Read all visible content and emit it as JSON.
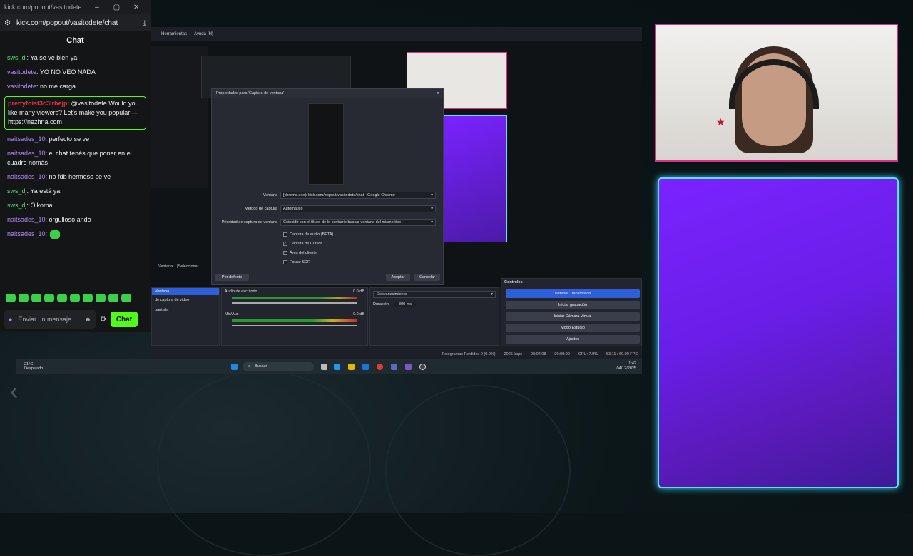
{
  "browser": {
    "tab_title": "kick.com/popout/vasitodete...",
    "url": "kick.com/popout/vasitodete/chat"
  },
  "chat": {
    "header": "Chat",
    "messages": [
      {
        "user": "sws_dj",
        "text": ": Ya se ve bien ya",
        "cls": "u1"
      },
      {
        "user": "vasitodete",
        "text": ": YO NO VEO NADA",
        "cls": "u2"
      },
      {
        "user": "vasitodete",
        "text": ": no me carga",
        "cls": "u2"
      },
      {
        "user": "prettyfoist3c3lrbejp",
        "text": ": @vasitodete Would you like many viewers? Let's make you popular — https://nezhna.com",
        "cls": "u3",
        "highlight": true
      },
      {
        "user": "naitsades_10",
        "text": ": perfecto se ve",
        "cls": "u2"
      },
      {
        "user": "naitsades_10",
        "text": ": el chat tenés que poner en el cuadro nomás",
        "cls": "u2"
      },
      {
        "user": "naitsades_10",
        "text": ": no fdb hermoso se ve",
        "cls": "u2"
      },
      {
        "user": "sws_dj",
        "text": ": Ya está ya",
        "cls": "u1"
      },
      {
        "user": "sws_dj",
        "text": ": Oikoma",
        "cls": "u1"
      },
      {
        "user": "naitsades_10",
        "text": ": orgulloso ando",
        "cls": "u2"
      },
      {
        "user": "naitsades_10",
        "text": ":",
        "cls": "u2"
      }
    ],
    "input_placeholder": "Enviar un mensaje",
    "send_label": "Chat"
  },
  "obs": {
    "menu": [
      "Herramientas",
      "Ayuda (H)"
    ],
    "dialog_title": "Propiedades para 'Captura de ventana'",
    "fields": [
      {
        "label": "Ventana",
        "value": "[chrome.exe]: kick.com/popout/vasitodete/chat - Google Chrome"
      },
      {
        "label": "Método de captura",
        "value": "Automático"
      },
      {
        "label": "Prioridad de captura de ventana",
        "value": "Coincidir con el título, de lo contrario buscar ventana del mismo tipo"
      }
    ],
    "checks": [
      {
        "label": "Captura de audio (BETA)",
        "checked": false
      },
      {
        "label": "Captura de Cursor",
        "checked": true
      },
      {
        "label": "Área del cliente",
        "checked": true
      },
      {
        "label": "Forzar SDR",
        "checked": false
      }
    ],
    "defaults_btn": "Por defecto",
    "ok_btn": "Aceptar",
    "cancel_btn": "Cancelar",
    "sources_bar": "Ventana",
    "sources_bar2": "[Seleccionar",
    "sources": [
      "Ventana",
      "de captura de video",
      "pantalla"
    ],
    "mixer": [
      {
        "name": "Audio de escritorio",
        "db": "0.0 dB"
      },
      {
        "name": "Mic/Aux",
        "db": "0.0 dB"
      }
    ],
    "transition": "Desvanecimiento",
    "duration_label": "Duración",
    "duration": "300 ms",
    "controls_title": "Controles",
    "controls": [
      "Detener Transmisión",
      "Iniciar grabación",
      "Iniciar Cámara Virtual",
      "Modo Estudio",
      "Ajustes"
    ],
    "status": [
      "Fotogramas Perdidos 0 (0.0%)",
      "2026 kbps",
      "00:04:08",
      "00:00:00",
      "CPU: 7.9%",
      "53.11 / 60.00 FPS"
    ]
  },
  "taskbar": {
    "weather_temp": "21°C",
    "weather_desc": "Despejado",
    "search": "Buscar",
    "time": "1:42",
    "date": "04/12/2025"
  },
  "colors": {
    "kick_green": "#53fc18",
    "cam_border": "#d63384",
    "panel_glow": "#5ee0f2",
    "stream_blue": "#2e5fd9"
  }
}
